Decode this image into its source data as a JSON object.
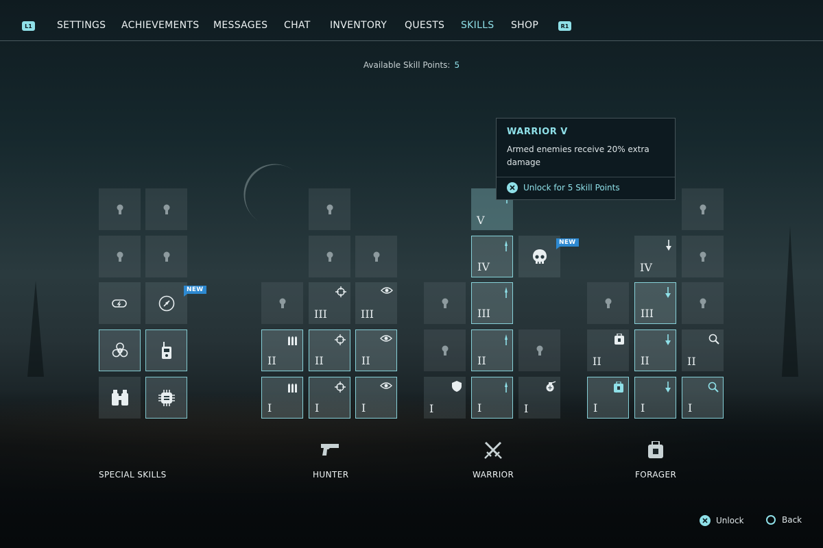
{
  "nav": {
    "left_badge": "L1",
    "right_badge": "R1",
    "tabs": [
      "SETTINGS",
      "ACHIEVEMENTS",
      "MESSAGES",
      "CHAT",
      "INVENTORY",
      "QUESTS",
      "SKILLS",
      "SHOP"
    ],
    "active_tab": "SKILLS"
  },
  "skill_points": {
    "label": "Available Skill Points:",
    "value": "5"
  },
  "tooltip": {
    "title": "WARRIOR V",
    "description": "Armed enemies receive 20% extra damage",
    "action": "Unlock for 5 Skill Points"
  },
  "levels": {
    "i": "I",
    "ii": "II",
    "iii": "III",
    "iv": "IV",
    "v": "V"
  },
  "new_label": "NEW",
  "categories": {
    "special": "SPECIAL SKILLS",
    "hunter": "HUNTER",
    "warrior": "WARRIOR",
    "forager": "FORAGER"
  },
  "hints": {
    "unlock": "Unlock",
    "back": "Back"
  },
  "colors": {
    "accent": "#8fe0e8",
    "new_badge": "#2d89d1",
    "tooltip_bg": "#0d1a20"
  },
  "icons": {
    "special": [
      "battery-icon",
      "compass-icon",
      "biohazard-icon",
      "radio-icon",
      "binoculars-icon",
      "chip-icon"
    ],
    "hunter": [
      "ammo-icon",
      "crosshair-icon",
      "eye-icon"
    ],
    "warrior": [
      "shield-icon",
      "knife-icon",
      "grenade-icon",
      "skull-icon"
    ],
    "forager": [
      "backpack-icon",
      "shovel-icon",
      "magnifier-icon"
    ]
  }
}
